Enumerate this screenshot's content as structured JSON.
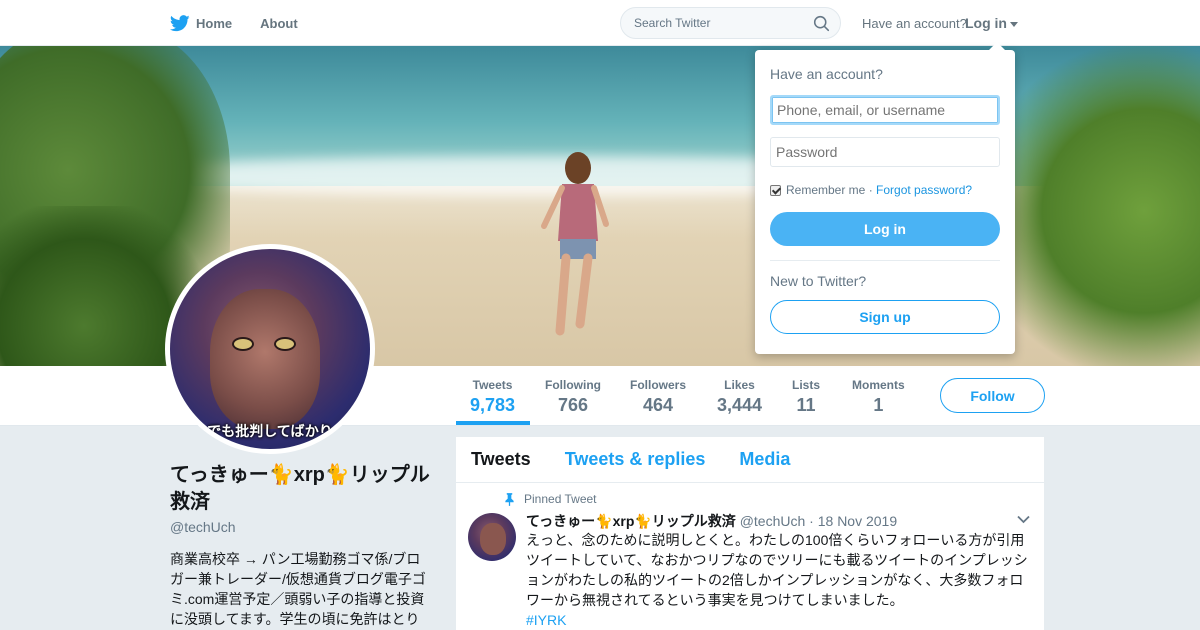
{
  "nav": {
    "home_label": "Home",
    "about_label": "About",
    "search_placeholder": "Search Twitter",
    "have_account": "Have an account?",
    "login_label": "Log in"
  },
  "avatar": {
    "caption": "でも批判してばかり"
  },
  "stats": [
    {
      "label": "Tweets",
      "value": "9,783"
    },
    {
      "label": "Following",
      "value": "766"
    },
    {
      "label": "Followers",
      "value": "464"
    },
    {
      "label": "Likes",
      "value": "3,444"
    },
    {
      "label": "Lists",
      "value": "11"
    },
    {
      "label": "Moments",
      "value": "1"
    }
  ],
  "follow_label": "Follow",
  "profile": {
    "name": "てっきゅー🐈xrp🐈リップル救済",
    "handle": "@techUch",
    "bio": "商業高校卒 → パン工場勤務ゴマ係/ブロガー兼トレーダー/仮想通貨ブログ電子ゴミ.com運営予定／頭弱い子の指導と投資に没頭してます。学生の頃に免許はとり"
  },
  "timeline": {
    "tabs": [
      "Tweets",
      "Tweets & replies",
      "Media"
    ],
    "pinned_label": "Pinned Tweet",
    "tweet": {
      "name": "てっきゅー🐈xrp🐈リップル救済",
      "handle": "@techUch",
      "date": "18 Nov 2019",
      "text": "えっと、念のために説明しとくと。わたしの100倍くらいフォローいる方が引用ツイートしていて、なおかつリプなのでツリーにも載るツイートのインプレッションがわたしの私的ツイートの2倍しかインプレッションがなく、大多数フォロワーから無視されてるという事実を見つけてしまいました。",
      "hashtag": "#IYRK"
    }
  },
  "login_dropdown": {
    "title": "Have an account?",
    "username_placeholder": "Phone, email, or username",
    "password_placeholder": "Password",
    "remember_label": "Remember me",
    "separator": " · ",
    "forgot_label": "Forgot password?",
    "login_button": "Log in",
    "new_label": "New to Twitter?",
    "signup_button": "Sign up"
  },
  "colors": {
    "accent": "#1da1f2",
    "login_button": "#4ab3f4",
    "background": "#e6ecf0"
  },
  "icons": [
    "twitter-bird-icon",
    "search-icon",
    "pin-icon",
    "chevron-down-icon"
  ]
}
